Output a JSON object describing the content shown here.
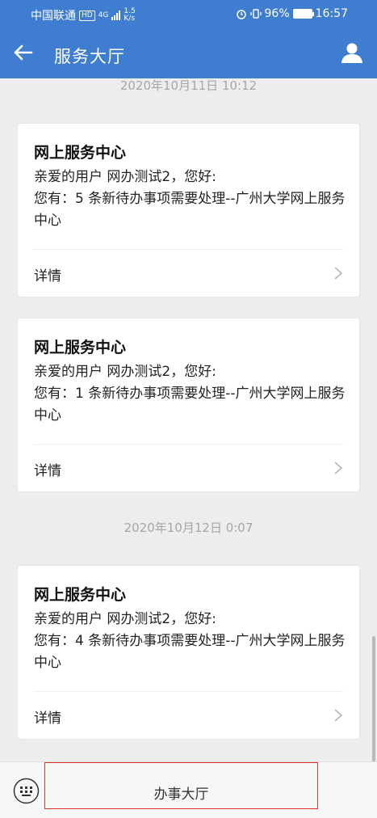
{
  "status_bar": {
    "carrier": "中国联通",
    "hd": "HD",
    "network": "4G",
    "speed_value": "1.5",
    "speed_unit": "K/s",
    "battery": "96%",
    "time": "16:57"
  },
  "header": {
    "title": "服务大厅",
    "back_icon": "arrow-left-icon",
    "user_icon": "person-icon",
    "color": "#3f7dd0"
  },
  "messages": [
    {
      "timestamp": "2020年10月11日  10:12",
      "cards": [
        {
          "title": "网上服务中心",
          "line1": "亲爱的用户 网办测试2，您好:",
          "line2": "您有：5 条新待办事项需要处理--广州大学网上服务中心",
          "detail": "详情"
        },
        {
          "title": "网上服务中心",
          "line1": "亲爱的用户 网办测试2，您好:",
          "line2": "您有：1 条新待办事项需要处理--广州大学网上服务中心",
          "detail": "详情"
        }
      ]
    },
    {
      "timestamp": "2020年10月12日  0:07",
      "cards": [
        {
          "title": "网上服务中心",
          "line1": "亲爱的用户 网办测试2，您好:",
          "line2": "您有：4 条新待办事项需要处理--广州大学网上服务中心",
          "detail": "详情"
        }
      ]
    }
  ],
  "bottom_bar": {
    "menu_label": "办事大厅",
    "keyboard_icon": "keyboard-icon"
  }
}
